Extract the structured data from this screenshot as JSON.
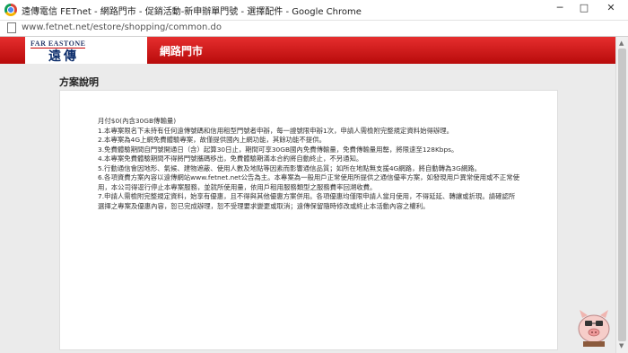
{
  "window": {
    "title": "遠傳電信 FETnet - 網路門市 - 促銷活動-新申辦單門號 - 選擇配件 - Google Chrome",
    "minimize_label": "─",
    "maximize_label": "□",
    "close_label": "✕"
  },
  "browser": {
    "url": "www.fetnet.net/estore/shopping/common.do"
  },
  "site": {
    "logo_en": "FAR EASTONE",
    "logo_zh": "遠傳",
    "nav_title": "網路門市"
  },
  "section": {
    "title": "方案說明"
  },
  "terms": {
    "heading": "月付$0(內含30GB傳輸量)",
    "items": [
      "1.本專案限名下未持有任何遠傳號碼和信用租型門號者申辦，每一證號限申辦1次，申請人需檢附完整規定資料始得辦理。",
      "2.本專案為4G上網免費體驗專案，故僅提供國內上網功能，其餘功能不提供。",
      "3.免費體驗期間自門號開通日（含）起算30日止，期間可享30GB國內免費傳輸量，免費傳輸量用罄，將限速至128Kbps。",
      "4.本專案免費體驗期間不得將門號攜碼移出，免費體驗期滿本合約將自動終止，不另通知。",
      "5.行動通信會因地形、氣候、建物遮蔽、使用人數及地點等因素而影響通信品質；如所在地點無支援4G網路，將自動轉為3G網路。",
      "6.各項資費方案內容以遠傳網站www.fetnet.net公告為主。本專案為一般用戶正常使用所提供之通信優率方案，如發現用戶異常使用或不正常使用，本公司得逕行停止本專案服務，並就所使用量，依用戶租用服務類型之服務費率回溯收費。",
      "7.申請人需檢附完整規定資料，始享有優惠，且不得與其他優惠方案併用。各項優惠均僅限申請人當月使用，不得延延、轉讓或折現。請確認所選擇之專案及優惠內容，恕已完成辦理，恕不受理要求變更或取消；遠傳保留隨時修改或終止本活動內容之權利。"
    ]
  },
  "icons": {
    "app": "chrome-icon",
    "page": "page-icon",
    "watermark": "pig-mascot-icon"
  },
  "colors": {
    "header_red": "#d41a1a",
    "logo_blue": "#0c2d6b",
    "content_bg": "#ebebeb"
  }
}
